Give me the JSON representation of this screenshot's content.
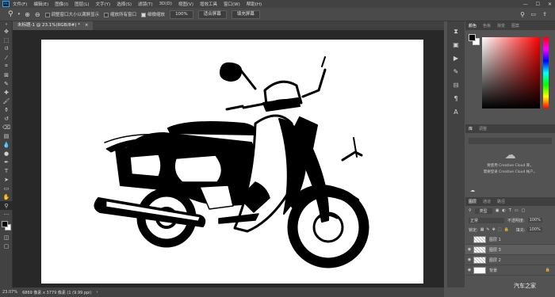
{
  "menubar": {
    "app_icon": "Ps",
    "items": [
      "文件(F)",
      "编辑(E)",
      "图像(I)",
      "图层(L)",
      "文字(Y)",
      "选择(S)",
      "滤镜(T)",
      "3D(D)",
      "视图(V)",
      "增效工具",
      "窗口(W)",
      "帮助(H)"
    ],
    "minimize": "—",
    "maximize": "☐",
    "close": "✕"
  },
  "options": {
    "resize_windows_label": "调整窗口大小以满屏显示",
    "zoom_all_label": "缩放所有窗口",
    "scrubby_label": "细微缩放",
    "zoom_value": "100%",
    "fit_screen": "适合屏幕",
    "fill_screen": "填充屏幕"
  },
  "document": {
    "tab_title": "未标题-1 @ 23.1%(RGB/8#) *",
    "close": "×"
  },
  "status": {
    "zoom": "23.07%",
    "info": "6869 像素 x 3779 像素 (1 (9.99 ppi)"
  },
  "color_panel": {
    "tabs": [
      "颜色",
      "色板",
      "渐变",
      "图案"
    ]
  },
  "libraries_panel": {
    "tabs": [
      "库",
      "调整"
    ],
    "message_line1": "要使用 Creative Cloud 库，",
    "message_line2": "需要登录 Creative Cloud 帐户。"
  },
  "layers_panel": {
    "tabs": [
      "图层",
      "通道",
      "路径"
    ],
    "filter_type": "类型",
    "blend_mode": "正常",
    "opacity_label": "不透明度:",
    "opacity_value": "100%",
    "lock_label": "锁定:",
    "fill_label": "填充:",
    "fill_value": "100%",
    "layers": [
      {
        "name": "图层 1",
        "visible": false
      },
      {
        "name": "图层 3",
        "visible": true
      },
      {
        "name": "图层 2",
        "visible": true
      },
      {
        "name": "背景",
        "visible": true
      }
    ]
  },
  "watermark": "汽车之家",
  "colors": {
    "foreground": "#000000",
    "background": "#ffffff",
    "accent": "#31a8ff"
  }
}
